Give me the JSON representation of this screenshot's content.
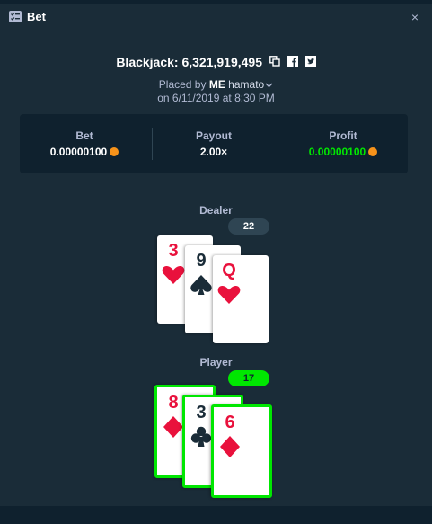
{
  "header": {
    "title": "Bet",
    "icon": "bet-list-icon",
    "close_icon": "close-icon",
    "close_label": "×"
  },
  "game": {
    "title": "Blackjack: 6,321,919,495",
    "placed_prefix": "Placed by",
    "badge": "ME",
    "username": "hamato",
    "date": "on 6/11/2019 at 8:30 PM"
  },
  "stats": {
    "bet": {
      "label": "Bet",
      "value": "0.00000100"
    },
    "payout": {
      "label": "Payout",
      "value": "2.00×"
    },
    "profit": {
      "label": "Profit",
      "value": "0.00000100"
    }
  },
  "dealer": {
    "label": "Dealer",
    "score": "22",
    "cards": [
      {
        "rank": "3",
        "suit": "hearts"
      },
      {
        "rank": "9",
        "suit": "spades"
      },
      {
        "rank": "Q",
        "suit": "hearts"
      }
    ]
  },
  "player": {
    "label": "Player",
    "score": "17",
    "cards": [
      {
        "rank": "8",
        "suit": "diamonds"
      },
      {
        "rank": "3",
        "suit": "clubs"
      },
      {
        "rank": "6",
        "suit": "diamonds"
      }
    ]
  },
  "colors": {
    "background": "#1a2c38",
    "panel": "#0f212e",
    "win_green": "#00e701",
    "card_red": "#e9113c",
    "card_black": "#1a2c38",
    "muted_text": "#b1bad3",
    "coin": "#f7931a"
  }
}
